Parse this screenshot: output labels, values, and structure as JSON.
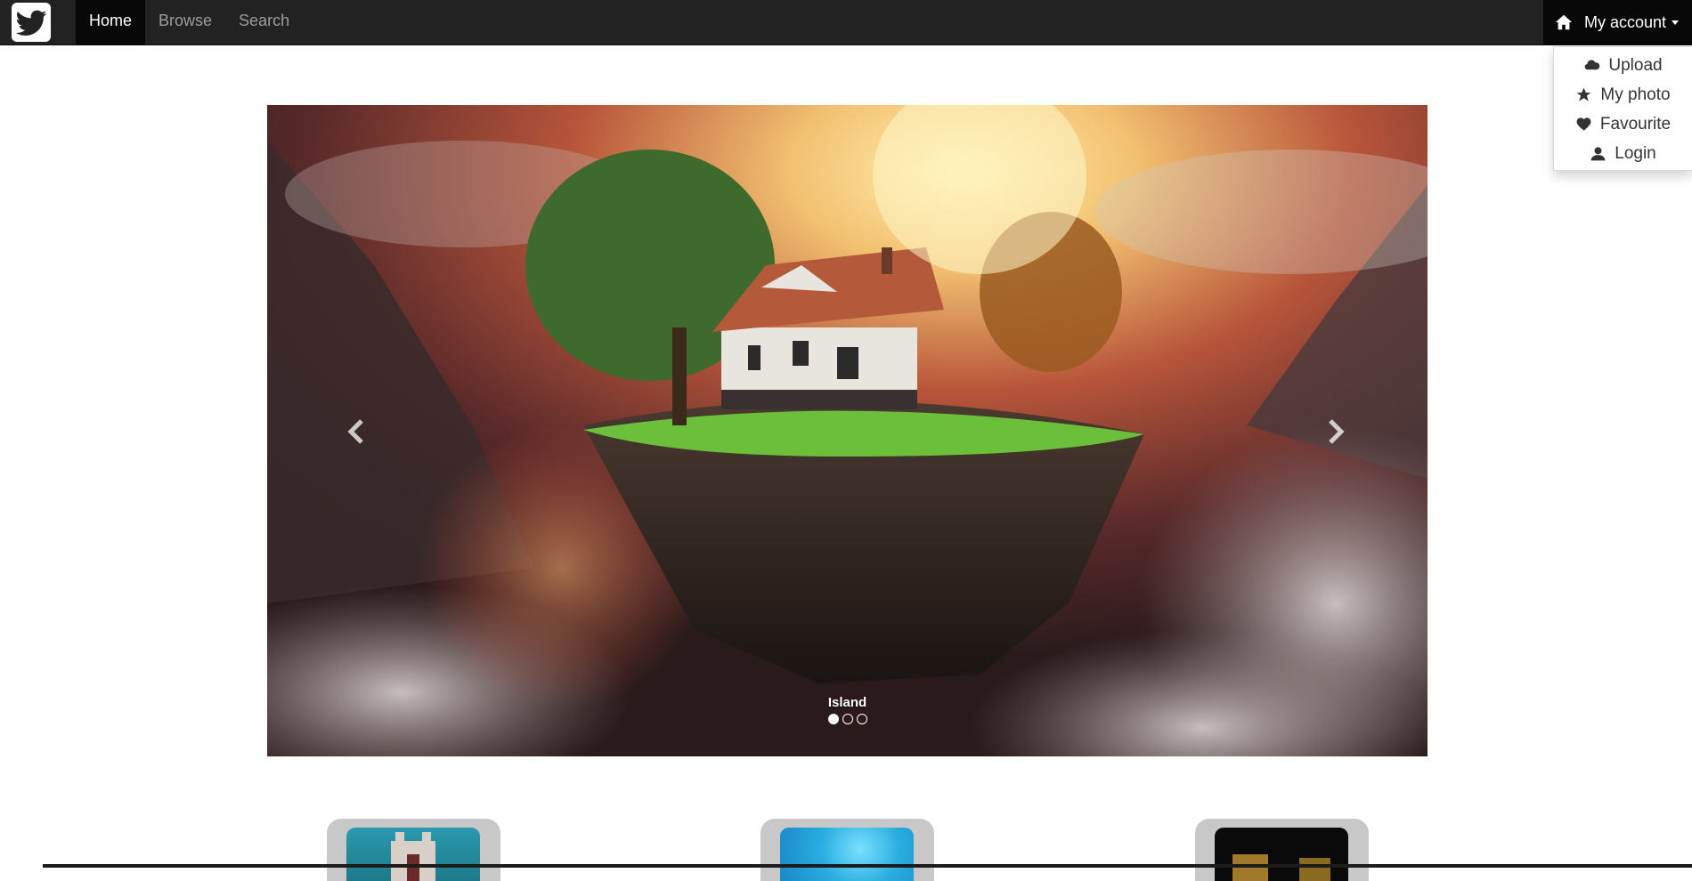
{
  "navbar": {
    "brand_icon": "twitter-bird-icon",
    "items": [
      {
        "label": "Home",
        "active": true
      },
      {
        "label": "Browse",
        "active": false
      },
      {
        "label": "Search",
        "active": false
      }
    ],
    "account": {
      "icon": "home-icon",
      "label": "My account"
    }
  },
  "dropdown": {
    "items": [
      {
        "label": "Upload",
        "icon": "cloud-icon"
      },
      {
        "label": "My photo",
        "icon": "star-icon"
      },
      {
        "label": "Favourite",
        "icon": "heart-icon"
      },
      {
        "label": "Login",
        "icon": "user-icon"
      }
    ]
  },
  "carousel": {
    "caption": "Island",
    "slide_count": 3,
    "active_index": 0
  },
  "thumbnails": [
    {
      "subject": "castle"
    },
    {
      "subject": "sky"
    },
    {
      "subject": "night-city"
    }
  ],
  "colors": {
    "navbar_bg": "#222222",
    "navbar_active_bg": "#080808",
    "nav_text": "#9d9d9d",
    "thumb_frame": "#c8c8c8"
  }
}
